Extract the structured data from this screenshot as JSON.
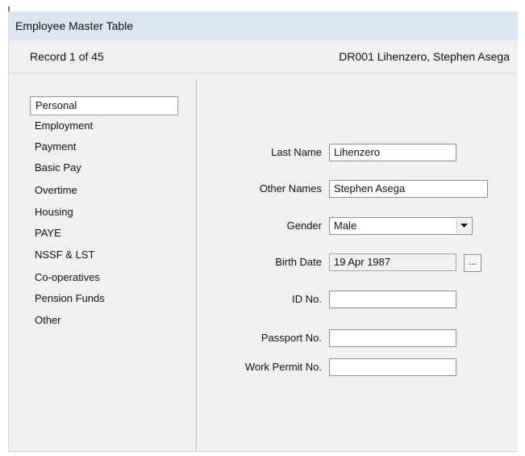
{
  "window": {
    "title": "Employee Master Table"
  },
  "record_bar": {
    "record_count": "Record 1 of 45",
    "record_name": "DR001  Lihenzero, Stephen Asega"
  },
  "nav": {
    "items": [
      {
        "label": "Personal",
        "active": true
      },
      {
        "label": "Employment"
      },
      {
        "label": "Payment"
      },
      {
        "label": "Basic Pay"
      },
      {
        "label": "Overtime"
      },
      {
        "label": "Housing"
      },
      {
        "label": "PAYE"
      },
      {
        "label": "NSSF & LST"
      },
      {
        "label": "Co-operatives"
      },
      {
        "label": "Pension Funds"
      },
      {
        "label": "Other"
      }
    ]
  },
  "form": {
    "last_name": {
      "label": "Last Name",
      "value": "Lihenzero"
    },
    "other_names": {
      "label": "Other Names",
      "value": "Stephen Asega"
    },
    "gender": {
      "label": "Gender",
      "value": "Male"
    },
    "birth_date": {
      "label": "Birth Date",
      "value": "19 Apr 1987",
      "button": "..."
    },
    "id_no": {
      "label": "ID No.",
      "value": ""
    },
    "passport_no": {
      "label": "Passport No.",
      "value": ""
    },
    "work_permit_no": {
      "label": "Work Permit No.",
      "value": ""
    }
  }
}
